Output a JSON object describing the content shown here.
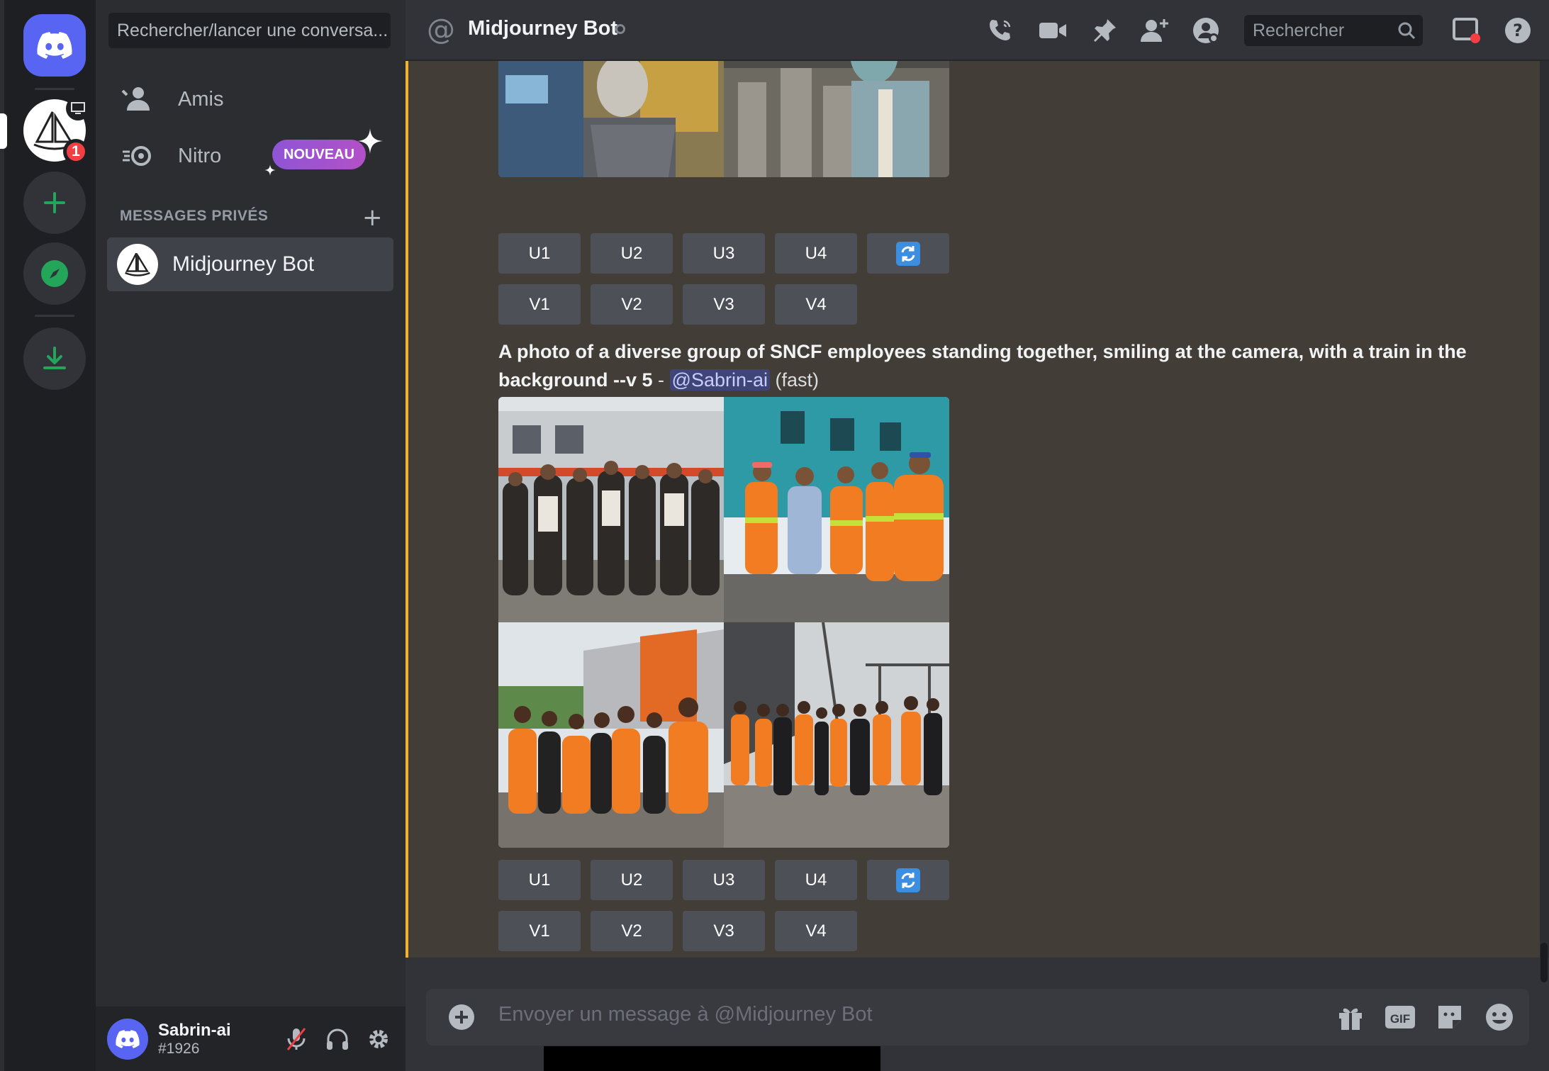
{
  "sidebar": {
    "search_placeholder": "Rechercher/lancer une conversa...",
    "friends_label": "Amis",
    "nitro_label": "Nitro",
    "nitro_badge": "NOUVEAU",
    "dm_header": "MESSAGES PRIVÉS",
    "dm_items": [
      {
        "name": "Midjourney Bot"
      }
    ]
  },
  "rail": {
    "server_badge_count": "1"
  },
  "user": {
    "name": "Sabrin-ai",
    "tag": "#1926"
  },
  "channel": {
    "title": "Midjourney Bot",
    "search_placeholder": "Rechercher"
  },
  "messages": {
    "upscale_buttons": [
      "U1",
      "U2",
      "U3",
      "U4"
    ],
    "variation_buttons": [
      "V1",
      "V2",
      "V3",
      "V4"
    ],
    "prompt_text": "A photo of a diverse group of SNCF employees standing together, smiling at the camera, with a train in the background --v 5",
    "prompt_separator": " - ",
    "mention": "@Sabrin-ai",
    "speed": "(fast)"
  },
  "composer": {
    "placeholder": "Envoyer un message à @Midjourney Bot",
    "gif_label": "GIF"
  },
  "colors": {
    "accent": "#5865f2",
    "highlight": "#f0b232",
    "green": "#23a55a",
    "danger": "#f23f43"
  }
}
